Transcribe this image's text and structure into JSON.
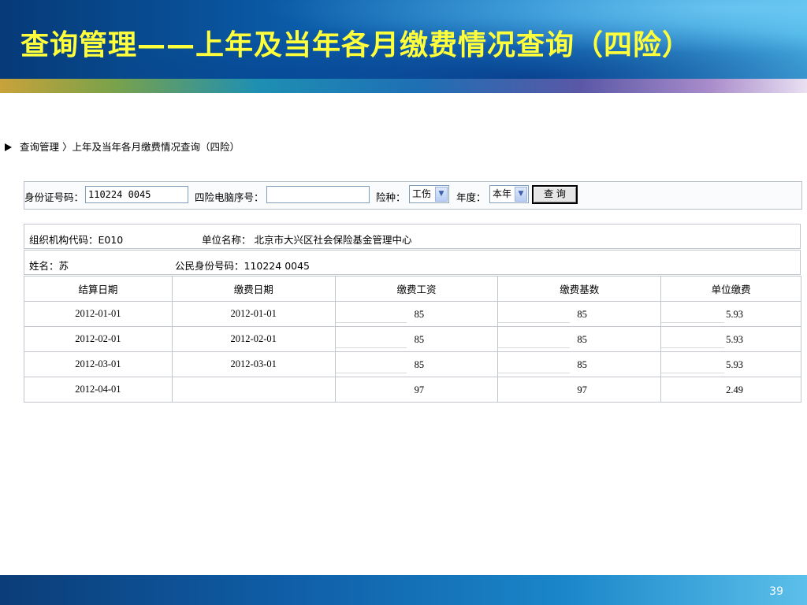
{
  "slide": {
    "title": "查询管理——上年及当年各月缴费情况查询（四险）",
    "page_number": "39"
  },
  "breadcrumb": "查询管理 〉上年及当年各月缴费情况查询（四险）",
  "form": {
    "id_label": "身份证号码：",
    "id_value": "110224       0045",
    "pc_label": "四险电脑序号：",
    "pc_value": "",
    "insurance_label": "险种：",
    "insurance_value": "工伤",
    "year_label": "年度：",
    "year_value": "本年",
    "query_button": "查 询"
  },
  "info": {
    "org_code_label": "组织机构代码：E010",
    "unit_name_label": "单位名称：  北京市大兴区社会保险基金管理中心",
    "name_label": "姓名：苏",
    "citizen_id_label": "公民身份号码：110224           0045"
  },
  "table": {
    "headers": [
      "结算日期",
      "缴费日期",
      "缴费工资",
      "缴费基数",
      "单位缴费"
    ],
    "rows": [
      [
        "2012-01-01",
        "2012-01-01",
        "85",
        "85",
        "5.93"
      ],
      [
        "2012-02-01",
        "2012-02-01",
        "85",
        "85",
        "5.93"
      ],
      [
        "2012-03-01",
        "2012-03-01",
        "85",
        "85",
        "5.93"
      ],
      [
        "2012-04-01",
        "",
        "97",
        "97",
        "2.49"
      ]
    ]
  }
}
